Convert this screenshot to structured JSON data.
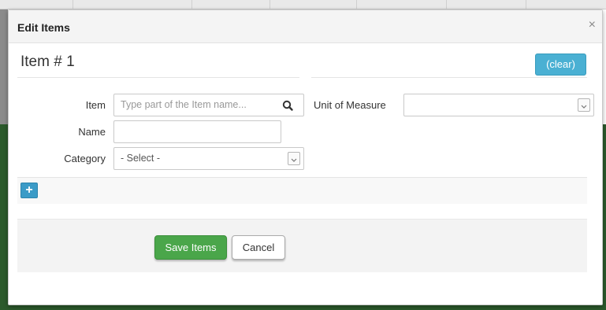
{
  "modal": {
    "title": "Edit Items",
    "close_icon": "×"
  },
  "item": {
    "heading": "Item # 1",
    "clear_label": "(clear)"
  },
  "fields": {
    "item_label": "Item",
    "item_placeholder": "Type part of the Item name...",
    "name_label": "Name",
    "name_value": "",
    "category_label": "Category",
    "category_selected": "- Select -",
    "uom_label": "Unit of Measure",
    "uom_selected": ""
  },
  "actions": {
    "add_label": "+",
    "save_label": "Save Items",
    "cancel_label": "Cancel"
  },
  "icons": {
    "search": "search-icon",
    "chevron": "chevron-down-icon",
    "close": "close-icon",
    "add": "plus-icon"
  },
  "colors": {
    "info": "#4ab0d3",
    "primary": "#3b9bc7",
    "success": "#4aa64a",
    "backdrop_green": "#2c5a2c"
  }
}
